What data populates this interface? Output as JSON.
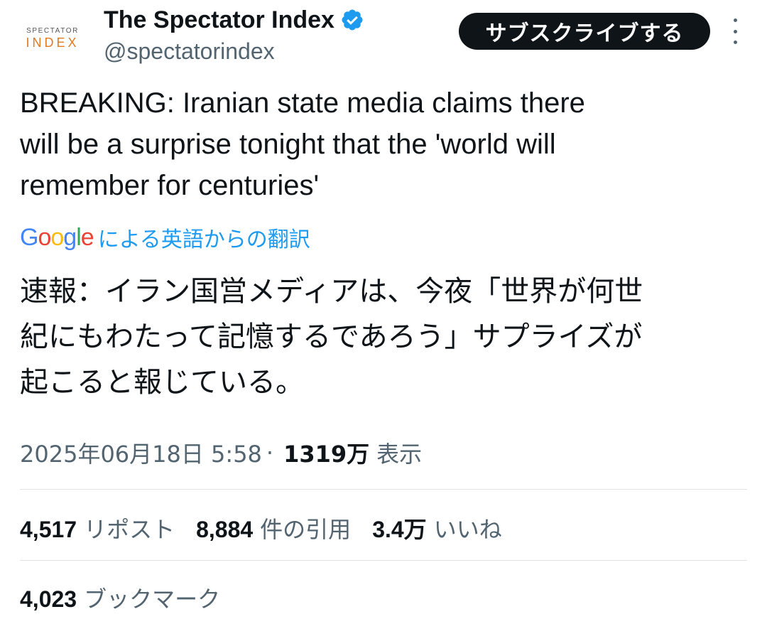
{
  "author": {
    "avatar_top": "SPECTATOR",
    "avatar_bottom": "INDEX",
    "display_name": "The Spectator Index",
    "handle": "@spectatorindex",
    "verified_icon": "verified-badge-icon",
    "verified_color": "#1d9bf0"
  },
  "subscribe_label": "サブスクライブする",
  "more_icon": "more-vertical-icon",
  "tweet": {
    "text_line1": "BREAKING: Iranian state media claims there",
    "text_line2": "will be a surprise tonight that the 'world will",
    "text_line3": "remember for centuries'",
    "translation_source": "Google",
    "translation_label": "による英語からの翻訳",
    "translated_line1": "速報：イラン国営メディアは、今夜「世界が何世",
    "translated_line2": "紀にもわたって記憶するであろう」サプライズが",
    "translated_line3": "起こると報じている。"
  },
  "meta": {
    "datetime": "2025年06月18日 5:58",
    "separator": "·",
    "views_count": "1319万",
    "views_label": "表示"
  },
  "stats": {
    "reposts_count": "4,517",
    "reposts_label": "リポスト",
    "quotes_count": "8,884",
    "quotes_label": "件の引用",
    "likes_count": "3.4万",
    "likes_label": "いいね",
    "bookmarks_count": "4,023",
    "bookmarks_label": "ブックマーク"
  },
  "colors": {
    "text_primary": "#0f1419",
    "text_secondary": "#536471",
    "accent": "#1d9bf0",
    "button_bg": "#0f1419"
  }
}
